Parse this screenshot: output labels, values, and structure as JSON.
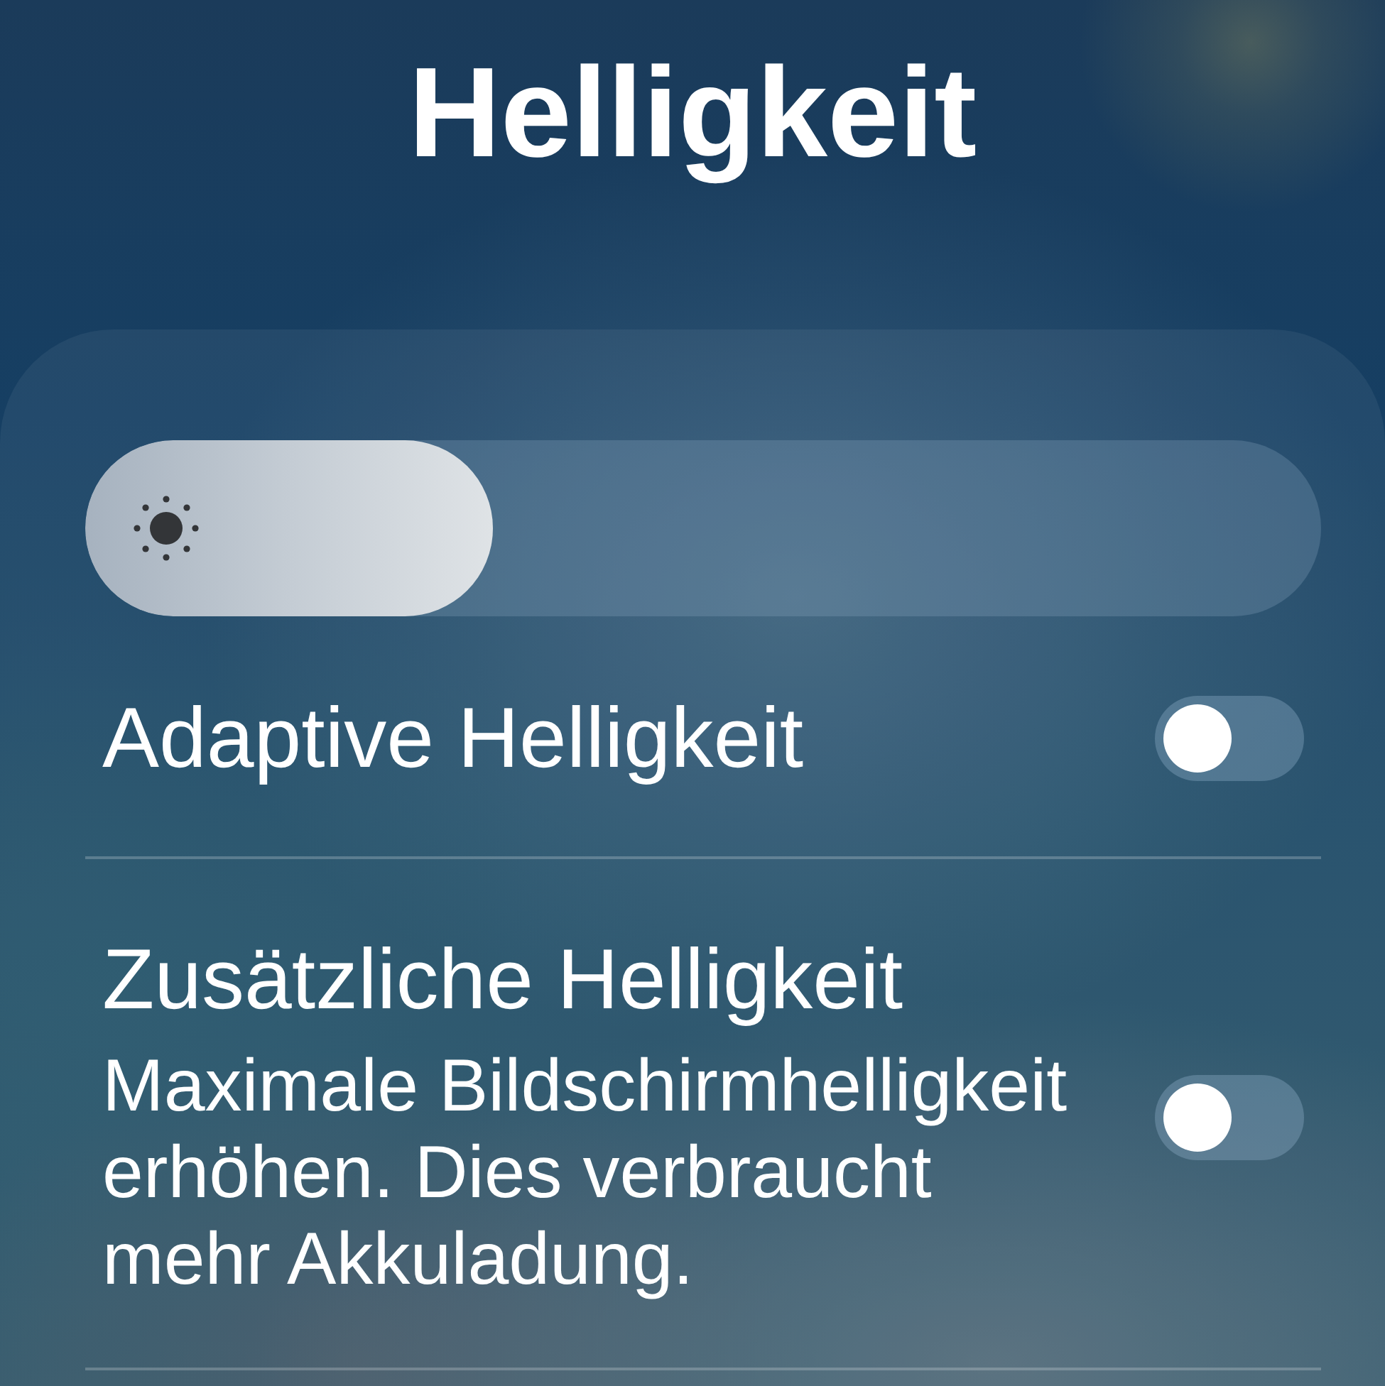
{
  "title": "Helligkeit",
  "brightness_slider": {
    "level": 0.33
  },
  "settings": [
    {
      "label": "Adaptive Helligkeit",
      "on": false
    },
    {
      "label": "Zusätzliche Helligkeit",
      "description": "Maximale Bildschirmhelligkeit erhöhen. Dies verbraucht mehr Akkuladung.",
      "on": false
    }
  ]
}
